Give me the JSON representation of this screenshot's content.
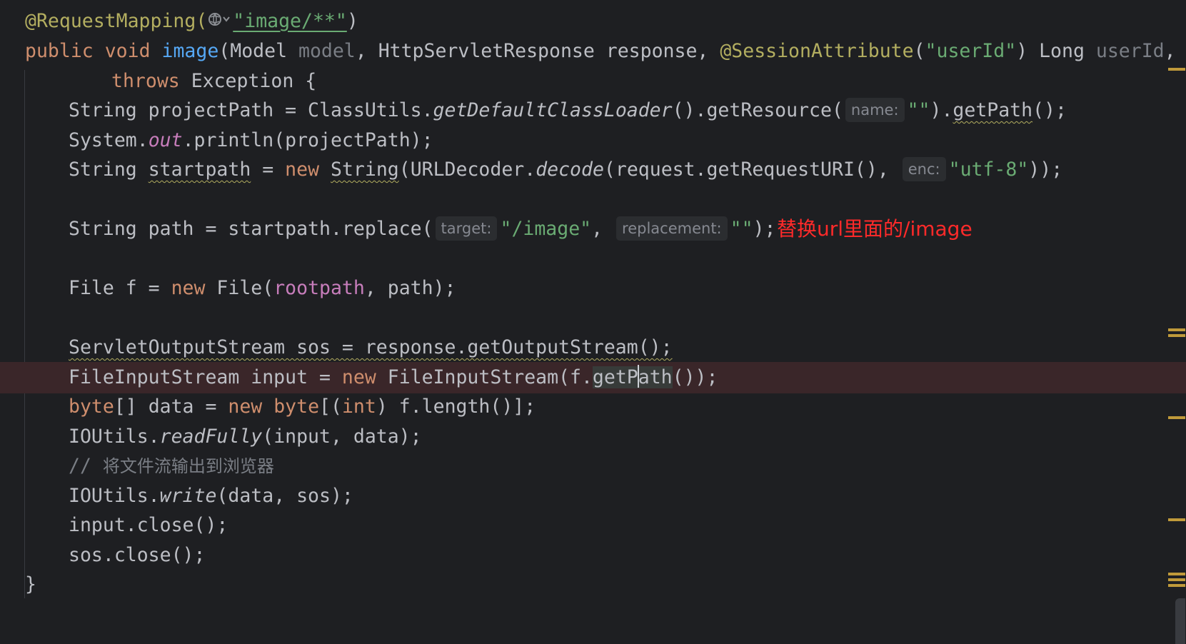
{
  "annotation_line": {
    "annotation": "@RequestMapping(",
    "icon": "globe-icon",
    "path": "\"image/**\"",
    "close": ")"
  },
  "signature": {
    "public": "public",
    "void": "void",
    "method": "image",
    "open": "(",
    "model_type": "Model ",
    "model_param": "model",
    "sep1": ", ",
    "response_decl": "HttpServletResponse response, ",
    "session_ann": "@SessionAttribute",
    "session_open": "(",
    "session_str": "\"userId\"",
    "session_close": ") ",
    "long_type": "Long ",
    "userid_param": "userId",
    "trail": ","
  },
  "throws_line": {
    "throws": "throws",
    "rest": " Exception {"
  },
  "project_path": {
    "prefix": "String projectPath = ClassUtils.",
    "method": "getDefaultClassLoader",
    "mid": "().getResource(",
    "hint": "name:",
    "arg": "\"\"",
    "after": ").",
    "getpath": "getPath",
    "end": "();"
  },
  "println_line": {
    "prefix": "System.",
    "out": "out",
    "rest": ".println(projectPath);"
  },
  "startpath_line": {
    "type": "String ",
    "var": "startpath",
    "eq": " = ",
    "new": "new",
    "space": " ",
    "string_cls": "String",
    "mid": "(URLDecoder.",
    "decode": "decode",
    "args": "(request.getRequestURI(), ",
    "hint": "enc:",
    "enc": "\"utf-8\"",
    "end": "));"
  },
  "replace_line": {
    "prefix": "String path = startpath.replace(",
    "hint_target": "target:",
    "target": "\"/image\"",
    "sep": ", ",
    "hint_replacement": "replacement:",
    "replacement": "\"\"",
    "end": ");",
    "note": "替换url里面的/image"
  },
  "file_line": {
    "prefix": "File f = ",
    "new": "new",
    "mid": " File(",
    "rootpath": "rootpath",
    "end": ", path);"
  },
  "sos_line": {
    "text": "ServletOutputStream sos = response.getOutputStream();"
  },
  "fis_line": {
    "prefix": "FileInputStream input = ",
    "new": "new",
    "mid": " FileInputStream(f.",
    "word_a": "getP",
    "word_b": "ath",
    "end": "());"
  },
  "byte_line": {
    "byte1": "byte",
    "mid1": "[] data = ",
    "new": "new",
    "space": " ",
    "byte2": "byte",
    "mid2": "[(",
    "int": "int",
    "end": ") f.length()];"
  },
  "readfully_line": {
    "prefix": "IOUtils.",
    "method": "readFully",
    "rest": "(input, data);"
  },
  "comment_line": {
    "slashes": "// ",
    "text": "将文件流输出到浏览器"
  },
  "write_line": {
    "prefix": "IOUtils.",
    "method": "write",
    "rest": "(data, sos);"
  },
  "input_close": {
    "text": "input.close();"
  },
  "sos_close": {
    "text": "sos.close();"
  },
  "closing_brace": {
    "text": "}"
  },
  "colors": {
    "background": "#1e1f22",
    "keyword": "#cf8e6d",
    "annotation": "#b3ae60",
    "string": "#6aab73",
    "field": "#c77dbb",
    "comment": "#7a7e85",
    "current_line": "#3a2629",
    "note": "#ff2a2a"
  }
}
